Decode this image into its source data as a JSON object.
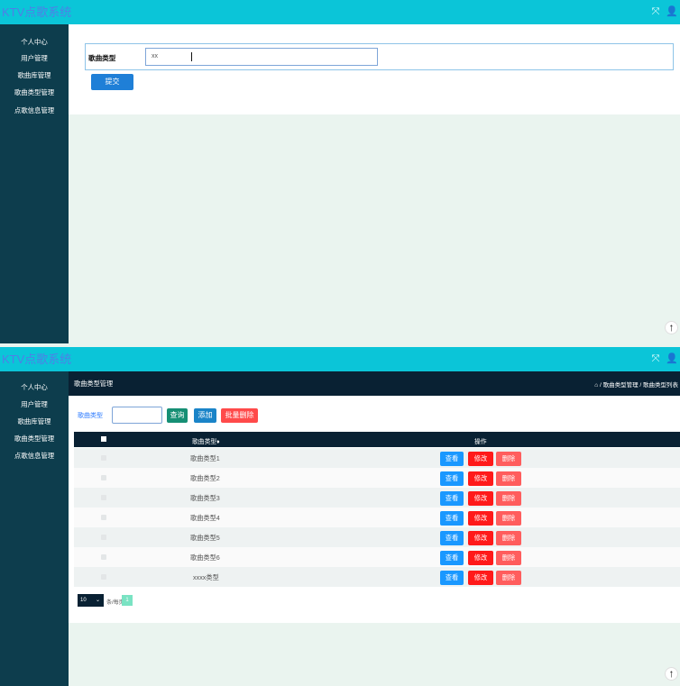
{
  "top": {
    "brand": "KTV点歌系统",
    "sidebar": [
      "个人中心",
      "用户管理",
      "歌曲库管理",
      "歌曲类型管理",
      "点歌信息管理"
    ],
    "form": {
      "label": "歌曲类型",
      "value": "xx",
      "submit": "提交"
    },
    "icons": {
      "expand": "⤧",
      "user": "👤",
      "up": "↑"
    }
  },
  "bottom": {
    "brand": "KTV点歌系统",
    "sidebar": [
      "个人中心",
      "用户管理",
      "歌曲库管理",
      "歌曲类型管理",
      "点歌信息管理"
    ],
    "header_title": "歌曲类型管理",
    "breadcrumb": "⌂ / 歌曲类型管理 / 歌曲类型列表",
    "search": {
      "label": "歌曲类型",
      "value": "",
      "query": "查询",
      "add": "添加",
      "batch_delete": "批量删除"
    },
    "table": {
      "columns": [
        "",
        "歌曲类型♦",
        "操作"
      ],
      "rows": [
        {
          "type": "歌曲类型1"
        },
        {
          "type": "歌曲类型2"
        },
        {
          "type": "歌曲类型3"
        },
        {
          "type": "歌曲类型4"
        },
        {
          "type": "歌曲类型5"
        },
        {
          "type": "歌曲类型6"
        },
        {
          "type": "xxxx类型"
        }
      ],
      "actions": {
        "view": "查看",
        "edit": "修改",
        "delete": "删除"
      }
    },
    "pagination": {
      "page_size": "10",
      "per_page_label": "条/每页",
      "current": "1"
    },
    "icons": {
      "expand": "⤧",
      "user": "👤",
      "up": "↑"
    }
  }
}
